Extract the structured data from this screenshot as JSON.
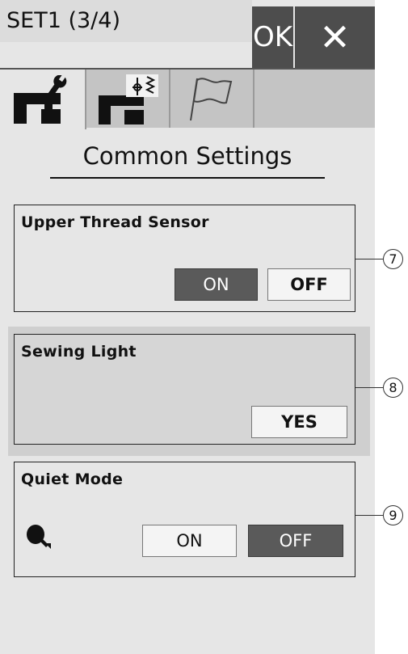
{
  "header": {
    "title": "SET1 (3/4)",
    "ok_label": "OK",
    "close_label": "✕"
  },
  "tabs": [
    {
      "name": "common-settings-tab",
      "icon": "machine-wrench-icon"
    },
    {
      "name": "machine-settings-tab",
      "icon": "machine-stitch-icon"
    },
    {
      "name": "language-tab",
      "icon": "flag-icon"
    }
  ],
  "page": {
    "title": "Common Settings"
  },
  "settings": {
    "upper_thread": {
      "label": "Upper Thread Sensor",
      "on_label": "ON",
      "off_label": "OFF",
      "selected": "ON",
      "callout": "7"
    },
    "sewing_light": {
      "label": "Sewing Light",
      "yes_label": "YES",
      "callout": "8"
    },
    "quiet_mode": {
      "label": "Quiet Mode",
      "icon": "quiet-mode-icon",
      "on_label": "ON",
      "off_label": "OFF",
      "selected": "OFF",
      "callout": "9"
    }
  },
  "colors": {
    "selected_button": "#5a5a5a",
    "header_button": "#4d4d4d",
    "screen_background": "#e6e6e6"
  }
}
